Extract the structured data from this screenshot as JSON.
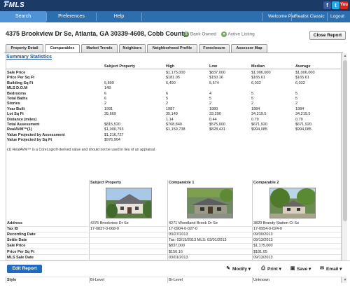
{
  "header": {
    "logo": "FMLS",
    "social": {
      "facebook": "f",
      "twitter": "t",
      "youtube": "You"
    }
  },
  "nav": {
    "tabs": [
      {
        "label": "Search"
      },
      {
        "label": "Preferences"
      },
      {
        "label": "Help"
      }
    ],
    "welcome": "Welcome Pat",
    "realist": "Realist Classic",
    "logout": "Logout"
  },
  "listing": {
    "address": "4375 Brookview Dr Se, Atlanta, GA 30339-4608, Cobb County",
    "bank_owned": "Bank Owned",
    "active_listing": "Active Listing",
    "close_report": "Close Report"
  },
  "tabs": [
    {
      "label": "Property Detail"
    },
    {
      "label": "Comparables"
    },
    {
      "label": "Market Trends"
    },
    {
      "label": "Neighbors"
    },
    {
      "label": "Neighborhood Profile"
    },
    {
      "label": "Foreclosure"
    },
    {
      "label": "Assessor Map"
    }
  ],
  "summary": {
    "title": "Summary Statistics",
    "columns": [
      "Subject Property",
      "High",
      "Low",
      "Median",
      "Average"
    ],
    "rows": [
      {
        "label": "Sale Price",
        "values": [
          "",
          "$1,175,000",
          "$837,000",
          "$1,006,000",
          "$1,006,000"
        ]
      },
      {
        "label": "Price Per Sq Ft",
        "values": [
          "",
          "$181.05",
          "$150.16",
          "$165.61",
          "$165.61"
        ]
      },
      {
        "label": "Building Sq Ft",
        "values": [
          "5,899",
          "6,490",
          "5,574",
          "6,032",
          "6,032"
        ]
      },
      {
        "label": "MLS D.O.M",
        "values": [
          "148",
          "",
          "",
          "",
          ""
        ]
      },
      {
        "label": "Bedrooms",
        "values": [
          "6",
          "6",
          "4",
          "5",
          "5"
        ]
      },
      {
        "label": "Total Baths",
        "values": [
          "6",
          "5",
          "5",
          "5",
          "5"
        ]
      },
      {
        "label": "Stories",
        "values": [
          "2",
          "2",
          "2",
          "2",
          "2"
        ]
      },
      {
        "label": "Year Built",
        "values": [
          "1991",
          "1987",
          "1980",
          "1984",
          "1984"
        ]
      },
      {
        "label": "Lot Sq Ft",
        "values": [
          "35,669",
          "35,149",
          "33,290",
          "34,219.5",
          "34,219.5"
        ]
      },
      {
        "label": "Distance (miles)",
        "values": [
          "",
          "1.14",
          "0.44",
          "0.79",
          "0.79"
        ]
      },
      {
        "label": "Total Assessment",
        "values": [
          "$815,520",
          "$768,840",
          "$575,000",
          "$671,920",
          "$671,920"
        ]
      },
      {
        "label": "RealAVM™(1)",
        "values": [
          "$1,000,793",
          "$1,159,738",
          "$828,431",
          "$994,085",
          "$994,085"
        ]
      },
      {
        "label": "Value Projected by Assessment",
        "values": [
          "$1,216,727",
          "",
          "",
          "",
          ""
        ]
      },
      {
        "label": "Value Projected by Sq Ft",
        "values": [
          "$976,904",
          "",
          "",
          "",
          ""
        ]
      }
    ],
    "footnote": "(1) RealAVM™ is a CoreLogic® derived value and should not be used in lieu of an appraisal."
  },
  "comparables": {
    "columns": [
      "Subject Property",
      "Comparable 1",
      "Comparable 2"
    ],
    "rows": [
      {
        "label": "Address",
        "values": [
          "4375 Brookview Dr Se",
          "4271 Woodland Brook Dr Se",
          "3820 Brandy Station Ct Se"
        ]
      },
      {
        "label": "Tax ID",
        "values": [
          "17-0837-0-068-0",
          "17-0904-0-027-0",
          "17-0954-0-024-0"
        ]
      },
      {
        "label": "Recording Date",
        "values": [
          "",
          "03/27/2013",
          "09/30/2013"
        ]
      },
      {
        "label": "Settle Date",
        "values": [
          "",
          "Tax: 03/15/2013 MLS: 03/01/2013",
          "09/13/2013"
        ]
      },
      {
        "label": "Sale Price",
        "values": [
          "",
          "$837,000",
          "$1,175,000"
        ]
      },
      {
        "label": "Price Per Sq Ft",
        "values": [
          "",
          "$150.16",
          "$181.05"
        ]
      },
      {
        "label": "MLS Sale Date",
        "values": [
          "",
          "03/01/2013",
          "09/13/2013"
        ]
      },
      {
        "label": "MLS Sale Price",
        "values": [
          "",
          "$837,000",
          "$1,175,000"
        ]
      },
      {
        "label": "MLS Listing #",
        "values": [
          "5190716",
          "5089555",
          "5174036"
        ]
      },
      {
        "label": "Building Sq Ft",
        "values": [
          "5,899",
          "Tax: 5,574 MLS: 5,316",
          "6,490"
        ]
      },
      {
        "label": "Style",
        "values": [
          "Bi-Level",
          "Bi-Level",
          "Unknown"
        ]
      }
    ]
  },
  "footer": {
    "edit_report": "Edit Report",
    "modify": "Modify",
    "print": "Print",
    "save": "Save",
    "email": "Email"
  }
}
